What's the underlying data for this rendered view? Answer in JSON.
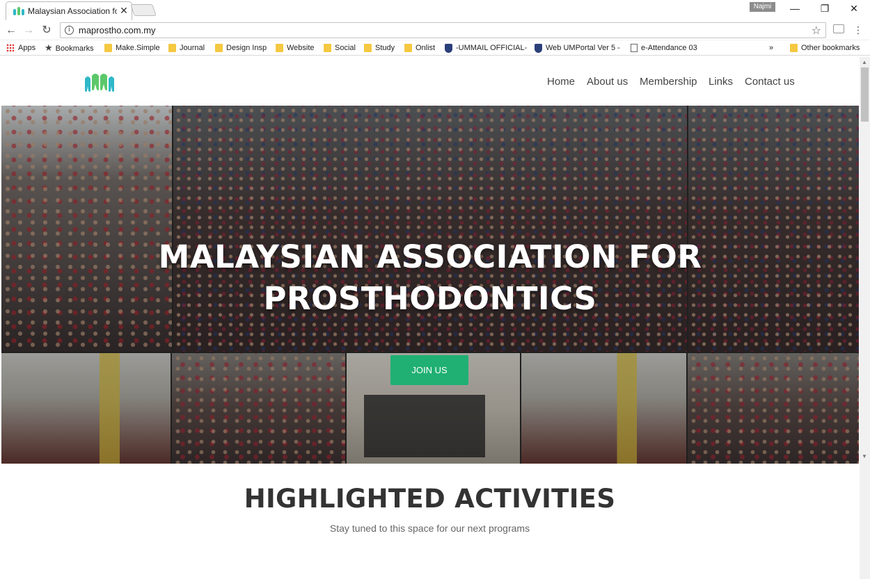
{
  "browser": {
    "tab_title": "Malaysian Association fo",
    "profile_name": "Najmi",
    "url": "maprostho.com.my",
    "bookmarks": [
      "Apps",
      "Bookmarks",
      "Make.Simple",
      "Journal",
      "Design Insp",
      "Website",
      "Social",
      "Study",
      "Onlist",
      "-UMMAIL OFFICIAL-",
      "Web UMPortal Ver 5 -",
      "e-Attendance 03"
    ],
    "overflow_chevron": "»",
    "other_bookmarks": "Other bookmarks"
  },
  "site": {
    "brand_colors": {
      "logo_teal": "#2fb8c8",
      "logo_green": "#5cc86a",
      "accent": "#20b073"
    },
    "nav": [
      "Home",
      "About us",
      "Membership",
      "Links",
      "Contact us"
    ],
    "hero": {
      "title_line1": "MALAYSIAN ASSOCIATION FOR",
      "title_line2": "PROSTHODONTICS",
      "cta": "JOIN US"
    },
    "section": {
      "title": "HIGHLIGHTED ACTIVITIES",
      "subtitle": "Stay tuned to this space for our next programs"
    }
  }
}
